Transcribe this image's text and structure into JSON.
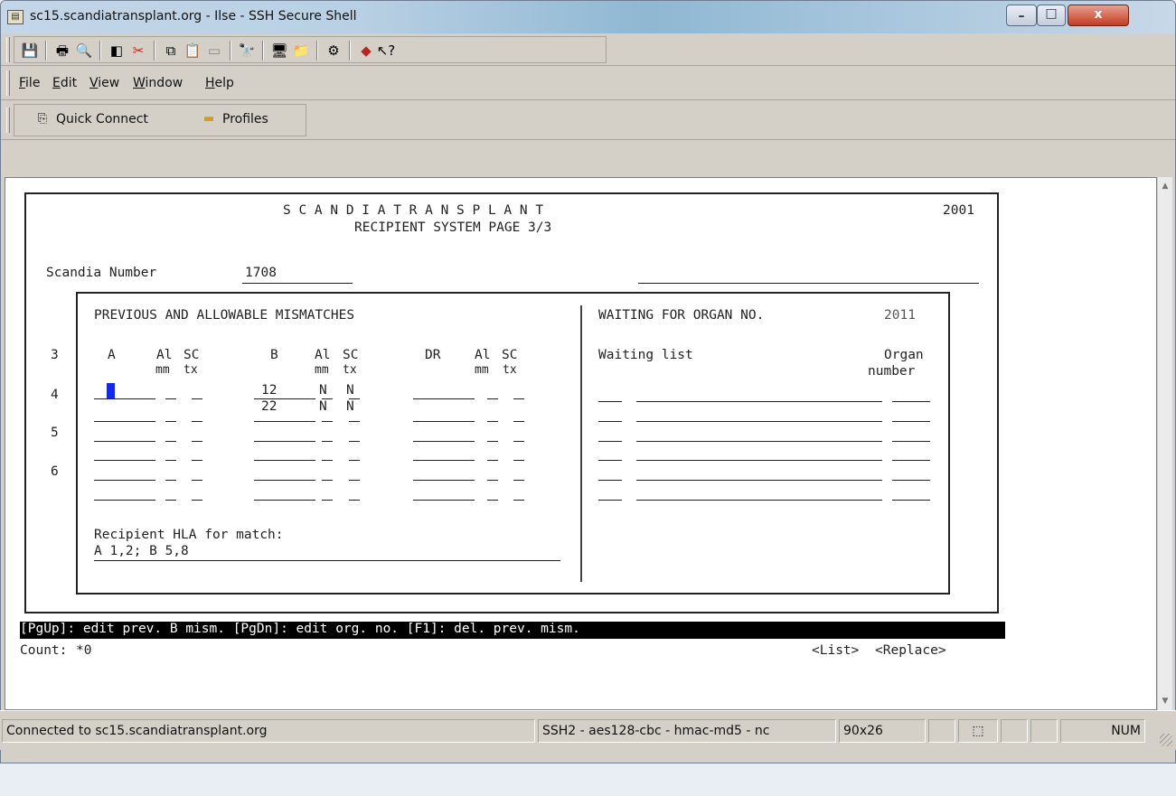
{
  "window": {
    "title": "sc15.scandiatransplant.org - Ilse - SSH Secure Shell",
    "minimize_glyph": "–",
    "maximize_glyph": "□",
    "close_glyph": "x"
  },
  "toolbar": {
    "icons": [
      "save-icon",
      "print-icon",
      "print-preview-icon",
      "disconnect-icon",
      "disconnect-red-icon",
      "copy-icon",
      "paste-icon",
      "paste-grey-icon",
      "find-icon",
      "new-terminal-icon",
      "new-file-transfer-icon",
      "settings-icon",
      "help-icon",
      "context-help-icon"
    ]
  },
  "menubar": {
    "items": [
      {
        "label": "File",
        "accel": "F",
        "rest": "ile"
      },
      {
        "label": "Edit",
        "accel": "E",
        "rest": "dit"
      },
      {
        "label": "View",
        "accel": "V",
        "rest": "iew"
      },
      {
        "label": "Window",
        "accel": "W",
        "rest": "indow"
      },
      {
        "label": "Help",
        "accel": "H",
        "rest": "elp"
      }
    ]
  },
  "quickbar": {
    "quick_connect": "Quick Connect",
    "profiles": "Profiles"
  },
  "terminal": {
    "header_line1": "S C A N D I A T R A N S P L A N T",
    "header_year": "2001",
    "header_line2": "RECIPIENT SYSTEM PAGE 3/3",
    "scandia_label": "Scandia Number",
    "scandia_value": "1708",
    "left_title": "PREVIOUS AND ALLOWABLE MISMATCHES",
    "right_title": "WAITING FOR ORGAN NO.",
    "right_title_value": "2011",
    "row_numbers": [
      "3",
      "4",
      "5",
      "6"
    ],
    "col_a": "A",
    "col_al1": "Al",
    "col_sc1": "SC",
    "col_b": "B",
    "col_al2": "Al",
    "col_sc2": "SC",
    "col_dr": "DR",
    "col_al3": "Al",
    "col_sc3": "SC",
    "sub_mm": "mm",
    "sub_tx": "tx",
    "b_values": [
      "12",
      "22"
    ],
    "n_values": [
      "N",
      "N",
      "N",
      "N"
    ],
    "waiting_list_label": "Waiting list",
    "organ_label": "Organ",
    "number_label": "number",
    "hla_label": "Recipient HLA for match:",
    "hla_value": "A 1,2; B 5,8",
    "help_line": "[PgUp]: edit prev. B mism. [PgDn]: edit org. no. [F1]: del. prev. mism.",
    "count_label": "Count:",
    "count_value": "*0",
    "list_action": "<List>",
    "replace_action": "<Replace>"
  },
  "statusbar": {
    "connection": "Connected to sc15.scandiatransplant.org",
    "cipher": "SSH2 - aes128-cbc - hmac-md5 - nc",
    "size": "90x26",
    "num": "NUM"
  }
}
